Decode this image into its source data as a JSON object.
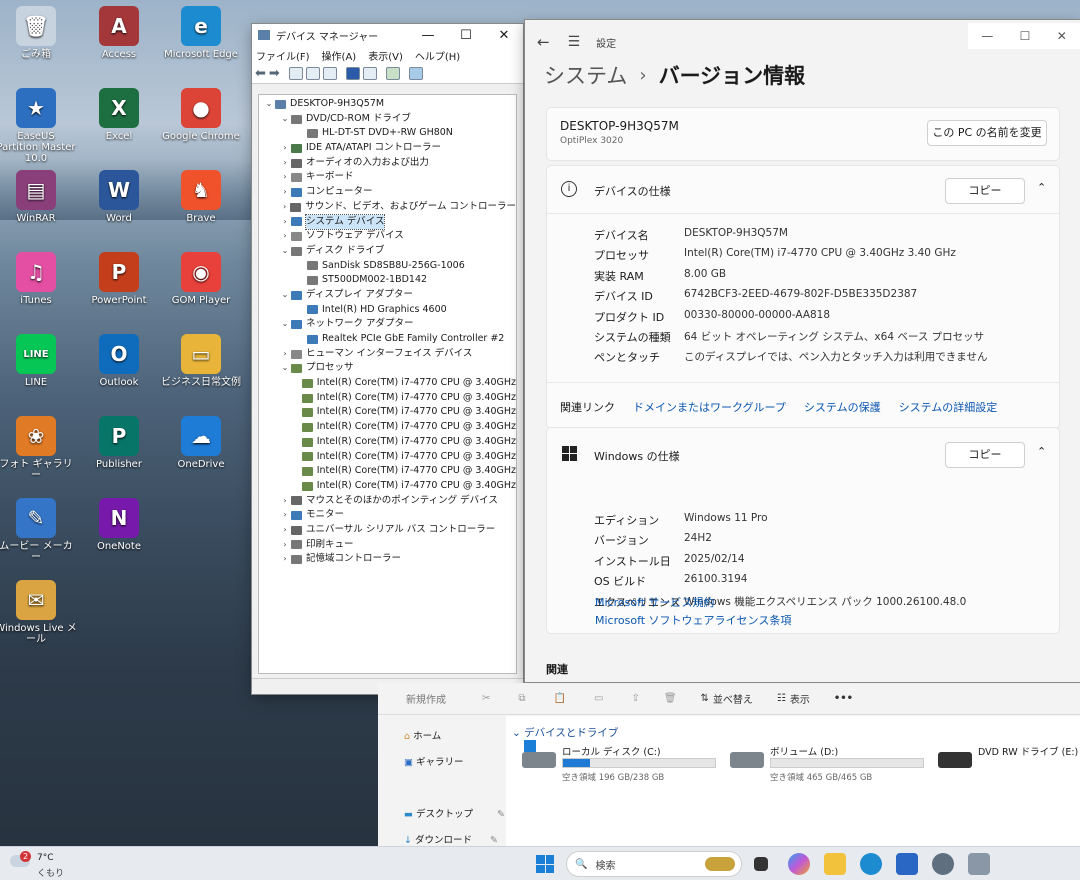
{
  "desktop": {
    "icons": [
      {
        "label": "ごみ箱",
        "glyph": "🗑",
        "color": "#c7d3df"
      },
      {
        "label": "Access",
        "glyph": "A",
        "color": "#a4373a"
      },
      {
        "label": "Microsoft Edge",
        "glyph": "e",
        "color": "#1c8bd0"
      },
      {
        "label": "EaseUS Partition Master 10.0",
        "glyph": "★",
        "color": "#2c6fc0"
      },
      {
        "label": "Excel",
        "glyph": "X",
        "color": "#1d6f42"
      },
      {
        "label": "Google Chrome",
        "glyph": "●",
        "color": "#db4437"
      },
      {
        "label": "WinRAR",
        "glyph": "▤",
        "color": "#8a3f7b"
      },
      {
        "label": "Word",
        "glyph": "W",
        "color": "#2b579a"
      },
      {
        "label": "Brave",
        "glyph": "♞",
        "color": "#f0522b"
      },
      {
        "label": "iTunes",
        "glyph": "♫",
        "color": "#e44fa3"
      },
      {
        "label": "PowerPoint",
        "glyph": "P",
        "color": "#c43e1c"
      },
      {
        "label": "GOM Player",
        "glyph": "◉",
        "color": "#e8403a"
      },
      {
        "label": "LINE",
        "glyph": "LINE",
        "color": "#06c755"
      },
      {
        "label": "Outlook",
        "glyph": "O",
        "color": "#0f6cbd"
      },
      {
        "label": "ビジネス日常文例",
        "glyph": "▭",
        "color": "#e8b53a"
      },
      {
        "label": "フォト ギャラリー",
        "glyph": "❀",
        "color": "#e07a24"
      },
      {
        "label": "Publisher",
        "glyph": "P",
        "color": "#077568"
      },
      {
        "label": "OneDrive",
        "glyph": "☁",
        "color": "#1e7bd6"
      },
      {
        "label": "ムービー メーカー",
        "glyph": "✎",
        "color": "#3575c8"
      },
      {
        "label": "OneNote",
        "glyph": "N",
        "color": "#7719aa"
      },
      {
        "label": "Windows Live メール",
        "glyph": "✉",
        "color": "#d9a441"
      }
    ]
  },
  "devmgr": {
    "title": "デバイス マネージャー",
    "menu": [
      "ファイル(F)",
      "操作(A)",
      "表示(V)",
      "ヘルプ(H)"
    ],
    "tree": [
      {
        "t": "DESKTOP-9H3Q57M",
        "l": 0,
        "a": "⌄",
        "c": "#5a7fa8"
      },
      {
        "t": "DVD/CD-ROM ドライブ",
        "l": 1,
        "a": "⌄",
        "c": "#777"
      },
      {
        "t": "HL-DT-ST DVD+-RW GH80N",
        "l": 2,
        "a": "",
        "c": "#777"
      },
      {
        "t": "IDE ATA/ATAPI コントローラー",
        "l": 1,
        "a": "›",
        "c": "#4a7a4a"
      },
      {
        "t": "オーディオの入力および出力",
        "l": 1,
        "a": "›",
        "c": "#666"
      },
      {
        "t": "キーボード",
        "l": 1,
        "a": "›",
        "c": "#888"
      },
      {
        "t": "コンピューター",
        "l": 1,
        "a": "›",
        "c": "#3c7ab8"
      },
      {
        "t": "サウンド、ビデオ、およびゲーム コントローラー",
        "l": 1,
        "a": "›",
        "c": "#666"
      },
      {
        "t": "システム デバイス",
        "l": 1,
        "a": "›",
        "c": "#3c7ab8",
        "sel": true
      },
      {
        "t": "ソフトウェア デバイス",
        "l": 1,
        "a": "›",
        "c": "#888"
      },
      {
        "t": "ディスク ドライブ",
        "l": 1,
        "a": "⌄",
        "c": "#777"
      },
      {
        "t": "SanDisk SD8SB8U-256G-1006",
        "l": 2,
        "a": "",
        "c": "#777"
      },
      {
        "t": "ST500DM002-1BD142",
        "l": 2,
        "a": "",
        "c": "#777"
      },
      {
        "t": "ディスプレイ アダプター",
        "l": 1,
        "a": "⌄",
        "c": "#3c7ab8"
      },
      {
        "t": "Intel(R) HD Graphics 4600",
        "l": 2,
        "a": "",
        "c": "#3c7ab8"
      },
      {
        "t": "ネットワーク アダプター",
        "l": 1,
        "a": "⌄",
        "c": "#3c7ab8"
      },
      {
        "t": "Realtek PCIe GbE Family Controller #2",
        "l": 2,
        "a": "",
        "c": "#3c7ab8"
      },
      {
        "t": "ヒューマン インターフェイス デバイス",
        "l": 1,
        "a": "›",
        "c": "#888"
      },
      {
        "t": "プロセッサ",
        "l": 1,
        "a": "⌄",
        "c": "#6a8a4a"
      },
      {
        "t": "Intel(R) Core(TM) i7-4770 CPU @ 3.40GHz",
        "l": 2,
        "a": "",
        "c": "#6a8a4a"
      },
      {
        "t": "Intel(R) Core(TM) i7-4770 CPU @ 3.40GHz",
        "l": 2,
        "a": "",
        "c": "#6a8a4a"
      },
      {
        "t": "Intel(R) Core(TM) i7-4770 CPU @ 3.40GHz",
        "l": 2,
        "a": "",
        "c": "#6a8a4a"
      },
      {
        "t": "Intel(R) Core(TM) i7-4770 CPU @ 3.40GHz",
        "l": 2,
        "a": "",
        "c": "#6a8a4a"
      },
      {
        "t": "Intel(R) Core(TM) i7-4770 CPU @ 3.40GHz",
        "l": 2,
        "a": "",
        "c": "#6a8a4a"
      },
      {
        "t": "Intel(R) Core(TM) i7-4770 CPU @ 3.40GHz",
        "l": 2,
        "a": "",
        "c": "#6a8a4a"
      },
      {
        "t": "Intel(R) Core(TM) i7-4770 CPU @ 3.40GHz",
        "l": 2,
        "a": "",
        "c": "#6a8a4a"
      },
      {
        "t": "Intel(R) Core(TM) i7-4770 CPU @ 3.40GHz",
        "l": 2,
        "a": "",
        "c": "#6a8a4a"
      },
      {
        "t": "マウスとそのほかのポインティング デバイス",
        "l": 1,
        "a": "›",
        "c": "#666"
      },
      {
        "t": "モニター",
        "l": 1,
        "a": "›",
        "c": "#3c7ab8"
      },
      {
        "t": "ユニバーサル シリアル バス コントローラー",
        "l": 1,
        "a": "›",
        "c": "#666"
      },
      {
        "t": "印刷キュー",
        "l": 1,
        "a": "›",
        "c": "#777"
      },
      {
        "t": "記憶域コントローラー",
        "l": 1,
        "a": "›",
        "c": "#777"
      }
    ]
  },
  "settings": {
    "app": "設定",
    "crumb_parent": "システム",
    "crumb_sep": "›",
    "crumb_current": "バージョン情報",
    "pc_name": "DESKTOP-9H3Q57M",
    "pc_model": "OptiPlex 3020",
    "rename_btn": "この PC の名前を変更",
    "device_spec": {
      "title": "デバイスの仕様",
      "copy": "コピー",
      "rows": [
        {
          "k": "デバイス名",
          "v": "DESKTOP-9H3Q57M"
        },
        {
          "k": "プロセッサ",
          "v": "Intel(R) Core(TM) i7-4770 CPU @ 3.40GHz   3.40 GHz"
        },
        {
          "k": "実装 RAM",
          "v": "8.00 GB"
        },
        {
          "k": "デバイス ID",
          "v": "6742BCF3-2EED-4679-802F-D5BE335D2387"
        },
        {
          "k": "プロダクト ID",
          "v": "00330-80000-00000-AA818"
        },
        {
          "k": "システムの種類",
          "v": "64 ビット オペレーティング システム、x64 ベース プロセッサ"
        },
        {
          "k": "ペンとタッチ",
          "v": "このディスプレイでは、ペン入力とタッチ入力は利用できません"
        }
      ]
    },
    "related_links": {
      "label": "関連リンク",
      "links": [
        "ドメインまたはワークグループ",
        "システムの保護",
        "システムの詳細設定"
      ]
    },
    "win_spec": {
      "title": "Windows の仕様",
      "copy": "コピー",
      "rows": [
        {
          "k": "エディション",
          "v": "Windows 11 Pro"
        },
        {
          "k": "バージョン",
          "v": "24H2"
        },
        {
          "k": "インストール日",
          "v": "2025/02/14"
        },
        {
          "k": "OS ビルド",
          "v": "26100.3194"
        },
        {
          "k": "エクスペリエンス",
          "v": "Windows 機能エクスペリエンス パック 1000.26100.48.0"
        }
      ],
      "links": [
        "Microsoft サービス規約",
        "Microsoft ソフトウェアライセンス条項"
      ]
    },
    "related": "関連"
  },
  "explorer": {
    "new_btn": "新規作成",
    "sort_btn": "並べ替え",
    "view_btn": "表示",
    "more": "•••",
    "nav": [
      {
        "label": "ホーム",
        "icon": "home-icon"
      },
      {
        "label": "ギャラリー",
        "icon": "gallery-icon"
      },
      {
        "label": "デスクトップ",
        "icon": "desktop-icon"
      },
      {
        "label": "ダウンロード",
        "icon": "download-icon"
      }
    ],
    "section": "デバイスとドライブ",
    "drives": [
      {
        "name": "ローカル ディスク (C:)",
        "free": "空き領域 196 GB/238 GB",
        "used_fraction": 0.18
      },
      {
        "name": "ボリューム (D:)",
        "free": "空き領域 465 GB/465 GB",
        "used_fraction": 0.0
      },
      {
        "name": "DVD RW ドライブ (E:)",
        "free": "",
        "used_fraction": null
      }
    ]
  },
  "taskbar": {
    "weather_temp": "7°C",
    "weather_text": "くもり",
    "weather_badge": "2",
    "search": "検索"
  }
}
